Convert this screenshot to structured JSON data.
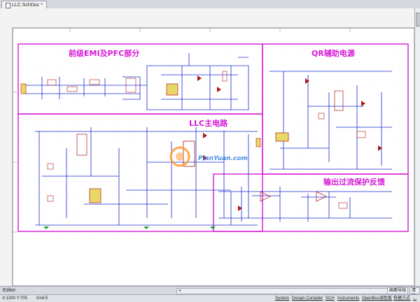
{
  "document_tab": {
    "title": "LLC.SchDoc *"
  },
  "schematic": {
    "section_titles": {
      "emi_pfc": "前级EMI及PFC部分",
      "qr_aux": "QR辅助电源",
      "llc_main": "LLC主电路",
      "overcurrent": "输出过流保护反馈"
    },
    "watermark": {
      "brand": "PianYuan.com"
    },
    "border_color": "#d61ad6",
    "wire_color": "#1a2cd6",
    "component_color": "#b01818"
  },
  "editor_bar": {
    "label": "Editor",
    "btn_a": "画面导线",
    "btn_b": "清除"
  },
  "status_bar": {
    "coords": "X:1300 Y:705",
    "grid": "Grid:5",
    "panels": [
      "System",
      "Design Compiler",
      "SCH",
      "Instruments",
      "OpenBus调色板",
      "快捷方式",
      "..."
    ]
  }
}
